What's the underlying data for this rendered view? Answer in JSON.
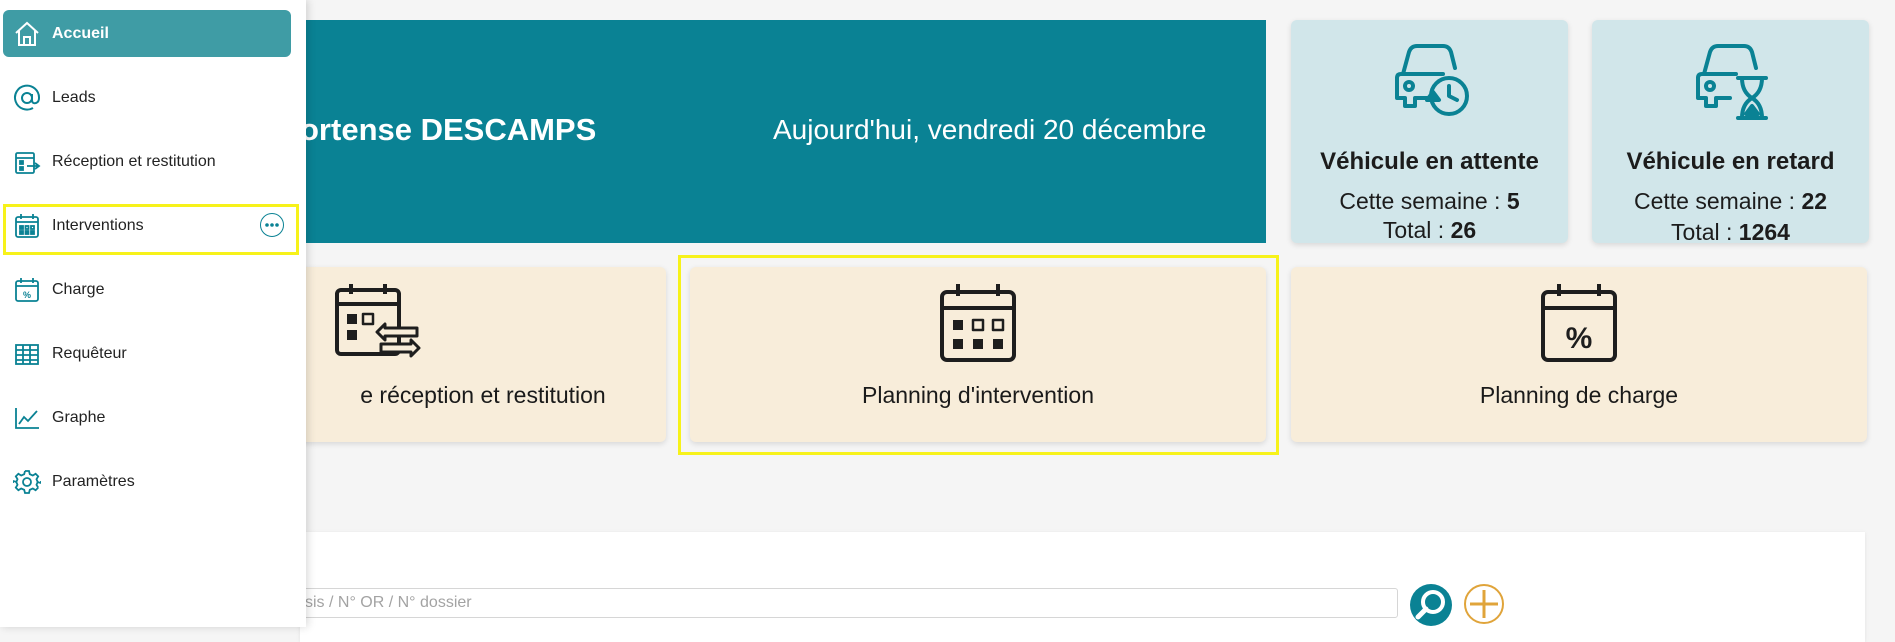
{
  "banner": {
    "user_name": "ortense DESCAMPS",
    "date_text": "Aujourd'hui, vendredi 20 décembre"
  },
  "stats": [
    {
      "title": "Véhicule en attente",
      "week_label": "Cette semaine : ",
      "week_value": "5",
      "total_label": "Total : ",
      "total_value": "26",
      "icon": "car-clock-icon"
    },
    {
      "title": "Véhicule en retard",
      "week_label": "Cette semaine : ",
      "week_value": "22",
      "total_label": "Total : ",
      "total_value": "1264",
      "icon": "car-hourglass-icon"
    }
  ],
  "tiles": [
    {
      "label": "e réception et restitution",
      "icon": "calendar-exchange-icon"
    },
    {
      "label": "Planning d'intervention",
      "icon": "calendar-grid-icon"
    },
    {
      "label": "Planning de charge",
      "icon": "calendar-percent-icon"
    }
  ],
  "search": {
    "placeholder": "sis / N° OR / N° dossier"
  },
  "sidebar": {
    "items": [
      {
        "label": "Accueil",
        "icon": "home-icon"
      },
      {
        "label": "Leads",
        "icon": "at-icon"
      },
      {
        "label": "Réception et restitution",
        "icon": "reception-icon"
      },
      {
        "label": "Interventions",
        "icon": "calendar-icon"
      },
      {
        "label": "Charge",
        "icon": "calendar-percent-icon"
      },
      {
        "label": "Requêteur",
        "icon": "table-icon"
      },
      {
        "label": "Graphe",
        "icon": "line-chart-icon"
      },
      {
        "label": "Paramètres",
        "icon": "gear-icon"
      }
    ]
  },
  "colors": {
    "primary": "#0a8294",
    "active_nav": "#3f9ca5",
    "stat_bg": "#d1e6ea",
    "tile_bg": "#f8edda",
    "highlight": "#f7f21a",
    "add_accent": "#e0a43a"
  }
}
